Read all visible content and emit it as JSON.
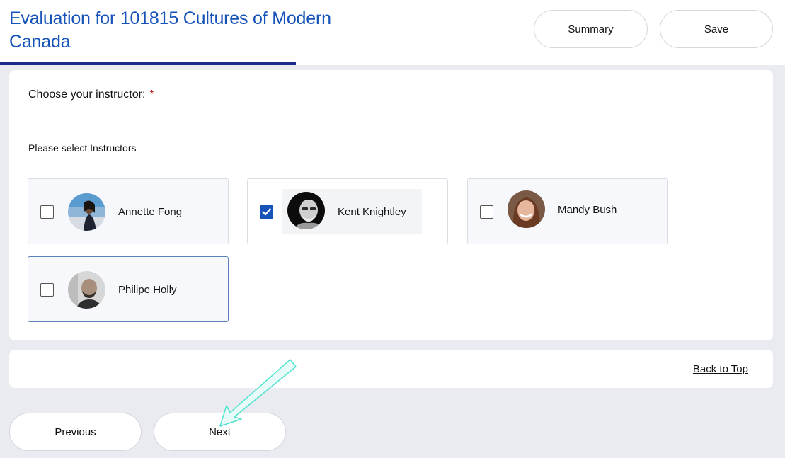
{
  "header": {
    "title": "Evaluation for 101815 Cultures of Modern Canada",
    "summary_label": "Summary",
    "save_label": "Save"
  },
  "question": {
    "label": "Choose your instructor:",
    "required_mark": "*",
    "hint": "Please select Instructors",
    "options": [
      {
        "name": "Annette Fong",
        "checked": false
      },
      {
        "name": "Kent Knightley",
        "checked": true
      },
      {
        "name": "Mandy Bush",
        "checked": false
      },
      {
        "name": "Philipe Holly",
        "checked": false
      }
    ]
  },
  "footer": {
    "back_to_top": "Back to Top"
  },
  "nav": {
    "previous_label": "Previous",
    "next_label": "Next"
  },
  "colors": {
    "accent": "#1553b8",
    "underline": "#1a2b8c",
    "required": "#c0272d",
    "annotation_arrow": "#4fe3cf"
  }
}
